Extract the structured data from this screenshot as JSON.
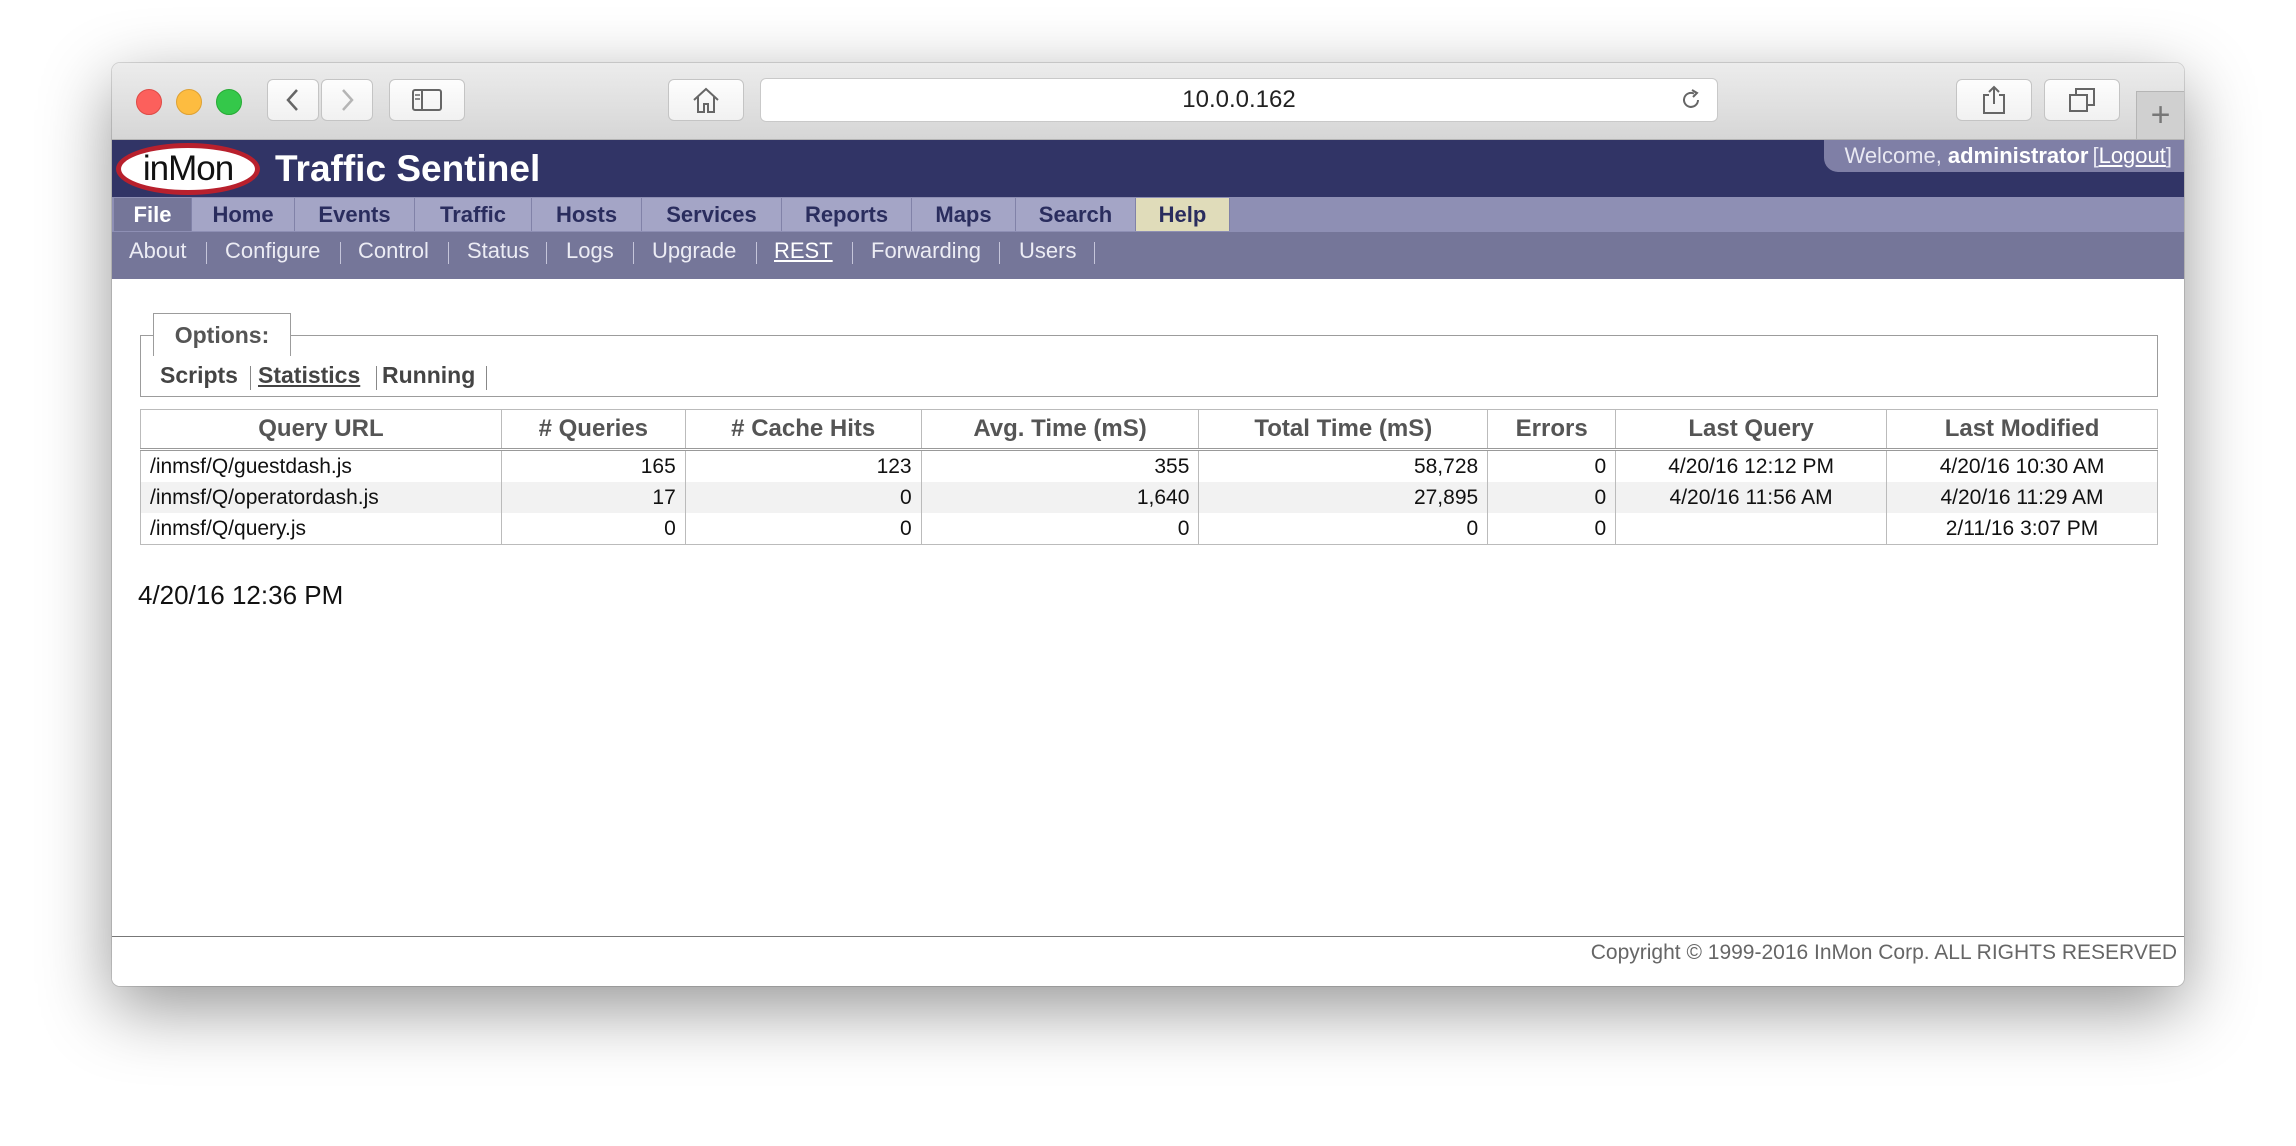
{
  "browser": {
    "address": "10.0.0.162",
    "icons": {
      "back": "chevron-left-icon",
      "forward": "chevron-right-icon",
      "sidebar": "sidebar-icon",
      "home": "home-icon",
      "reload": "reload-icon",
      "share": "share-icon",
      "tabs": "tabs-icon",
      "new_tab": "+"
    }
  },
  "header": {
    "logo_text": "inMon",
    "title": "Traffic Sentinel",
    "welcome_prefix": "Welcome,",
    "user": "administrator",
    "bracket_open": "[",
    "logout": "Logout",
    "bracket_close": "]"
  },
  "menu": [
    {
      "label": "File"
    },
    {
      "label": "Home"
    },
    {
      "label": "Events"
    },
    {
      "label": "Traffic"
    },
    {
      "label": "Hosts"
    },
    {
      "label": "Services"
    },
    {
      "label": "Reports"
    },
    {
      "label": "Maps"
    },
    {
      "label": "Search"
    },
    {
      "label": "Help"
    }
  ],
  "submenu": [
    {
      "label": "About"
    },
    {
      "label": "Configure"
    },
    {
      "label": "Control"
    },
    {
      "label": "Status"
    },
    {
      "label": "Logs"
    },
    {
      "label": "Upgrade"
    },
    {
      "label": "REST"
    },
    {
      "label": "Forwarding"
    },
    {
      "label": "Users"
    }
  ],
  "options": {
    "legend": "Options:",
    "items": [
      {
        "label": "Scripts"
      },
      {
        "label": "Statistics"
      },
      {
        "label": "Running"
      }
    ]
  },
  "table": {
    "headers": [
      "Query URL",
      "# Queries",
      "# Cache Hits",
      "Avg. Time (mS)",
      "Total Time (mS)",
      "Errors",
      "Last Query",
      "Last Modified"
    ],
    "rows": [
      [
        "/inmsf/Q/guestdash.js",
        "165",
        "123",
        "355",
        "58,728",
        "0",
        "4/20/16 12:12 PM",
        "4/20/16 10:30 AM"
      ],
      [
        "/inmsf/Q/operatordash.js",
        "17",
        "0",
        "1,640",
        "27,895",
        "0",
        "4/20/16 11:56 AM",
        "4/20/16 11:29 AM"
      ],
      [
        "/inmsf/Q/query.js",
        "0",
        "0",
        "0",
        "0",
        "0",
        "",
        "2/11/16 3:07 PM"
      ]
    ]
  },
  "timestamp": "4/20/16 12:36 PM",
  "footer": {
    "copyright": "Copyright © 1999-2016 InMon Corp. ALL RIGHTS RESERVED"
  }
}
